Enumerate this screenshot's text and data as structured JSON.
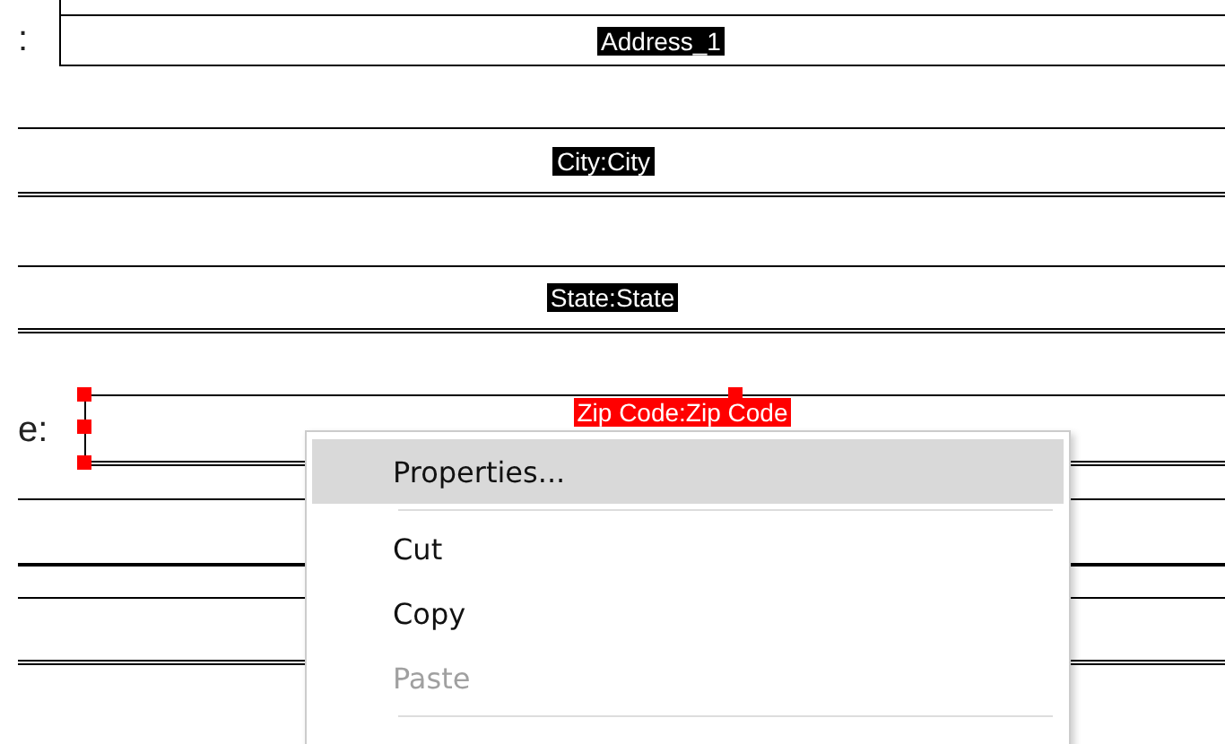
{
  "fields": [
    {
      "label": ":",
      "value": "Address_1",
      "kind": "boxed",
      "selected": false
    },
    {
      "value": "City:City",
      "kind": "band",
      "selected": false
    },
    {
      "value": "State:State",
      "kind": "band",
      "selected": false
    },
    {
      "label": "e:",
      "value": "Zip Code:Zip Code",
      "kind": "band",
      "selected": true
    }
  ],
  "context_menu": {
    "items": [
      {
        "kind": "item",
        "label": "Properties...",
        "selected": true,
        "disabled": false
      },
      {
        "kind": "separator"
      },
      {
        "kind": "item",
        "label": "Cut",
        "selected": false,
        "disabled": false
      },
      {
        "kind": "item",
        "label": "Copy",
        "selected": false,
        "disabled": false
      },
      {
        "kind": "item",
        "label": "Paste",
        "selected": false,
        "disabled": true
      },
      {
        "kind": "separator"
      }
    ]
  }
}
